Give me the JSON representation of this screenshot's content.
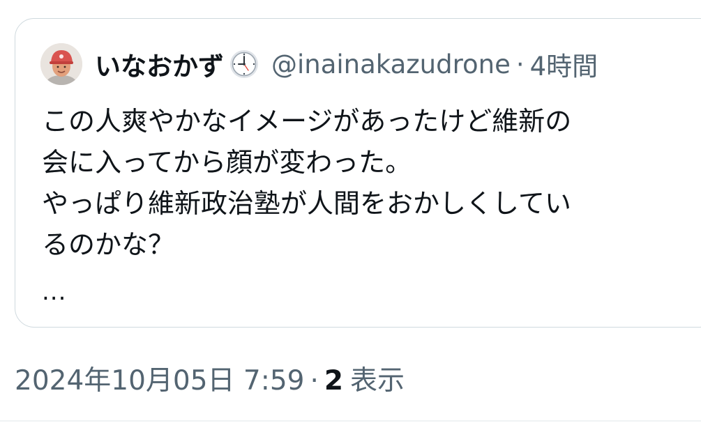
{
  "quoted_tweet": {
    "display_name": "いなおかず",
    "badge_icon": "clock-icon",
    "handle": "@inainakazudrone",
    "separator": "·",
    "relative_time": "4時間",
    "text_lines": [
      "この人爽やかなイメージがあったけど維新の",
      "会に入ってから顔が変わった。",
      "やっぱり維新政治塾が人間をおかしくしてい",
      "るのかな？"
    ],
    "truncation": "..."
  },
  "meta": {
    "timestamp": "2024年10月05日 7:59",
    "separator": "·",
    "views_count": "2",
    "views_label": "表示"
  },
  "colors": {
    "primary_text": "#0f1419",
    "secondary_text": "#536471",
    "border": "#cfd9de",
    "avatar_cap": "#d9534f"
  }
}
